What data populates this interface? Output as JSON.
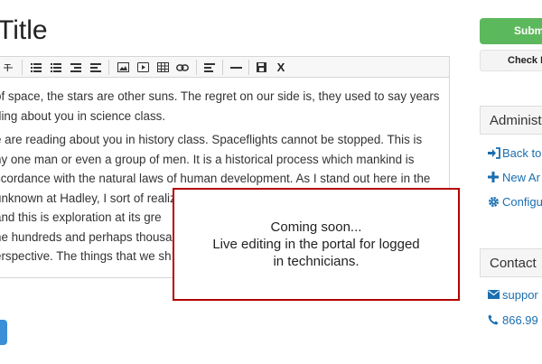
{
  "page": {
    "title": "Title"
  },
  "toolbar": {
    "icons": [
      "strike-icon",
      "bullet-list-icon",
      "numbered-list-icon",
      "outdent-icon",
      "indent-icon",
      "image-icon",
      "video-icon",
      "table-icon",
      "link-icon",
      "align-icon",
      "horizontal-rule-icon",
      "save-icon",
      "close-icon"
    ],
    "close_label": "X"
  },
  "editor": {
    "paragraph1": [
      "of space, the stars are other suns. The regret on our side is, they used to say years",
      "ding about you in science class."
    ],
    "paragraph2": [
      "e are reading about you in history class. Spaceflights cannot be stopped. This is",
      "ny one man or even a group of men. It is a historical process which mankind is",
      "ccordance with the natural laws of human development. As I stand out here in the",
      "unknown at Hadley, I sort of realiz",
      " and this is exploration at its gre",
      "he hundreds and perhaps thousa",
      "erspective. The things that we sh"
    ]
  },
  "overlay": {
    "line1": "Coming soon...",
    "line2": "Live editing in the portal for logged",
    "line3": "in technicians."
  },
  "sidebar": {
    "submit_label": "Submit",
    "check_label": "Check E",
    "admin": {
      "header": "Administ",
      "links": [
        {
          "icon": "sign-in-icon",
          "label": "Back to"
        },
        {
          "icon": "plus-icon",
          "label": "New Ar"
        },
        {
          "icon": "gear-icon",
          "label": "Configu"
        }
      ]
    },
    "contact": {
      "header": "Contact",
      "links": [
        {
          "icon": "envelope-icon",
          "label": "suppor"
        },
        {
          "icon": "phone-icon",
          "label": "866.99"
        }
      ]
    }
  },
  "colors": {
    "submit": "#5cb85c",
    "link": "#1a6eb0",
    "overlay_border": "#b30000",
    "primary_button": "#3a8fd6"
  }
}
